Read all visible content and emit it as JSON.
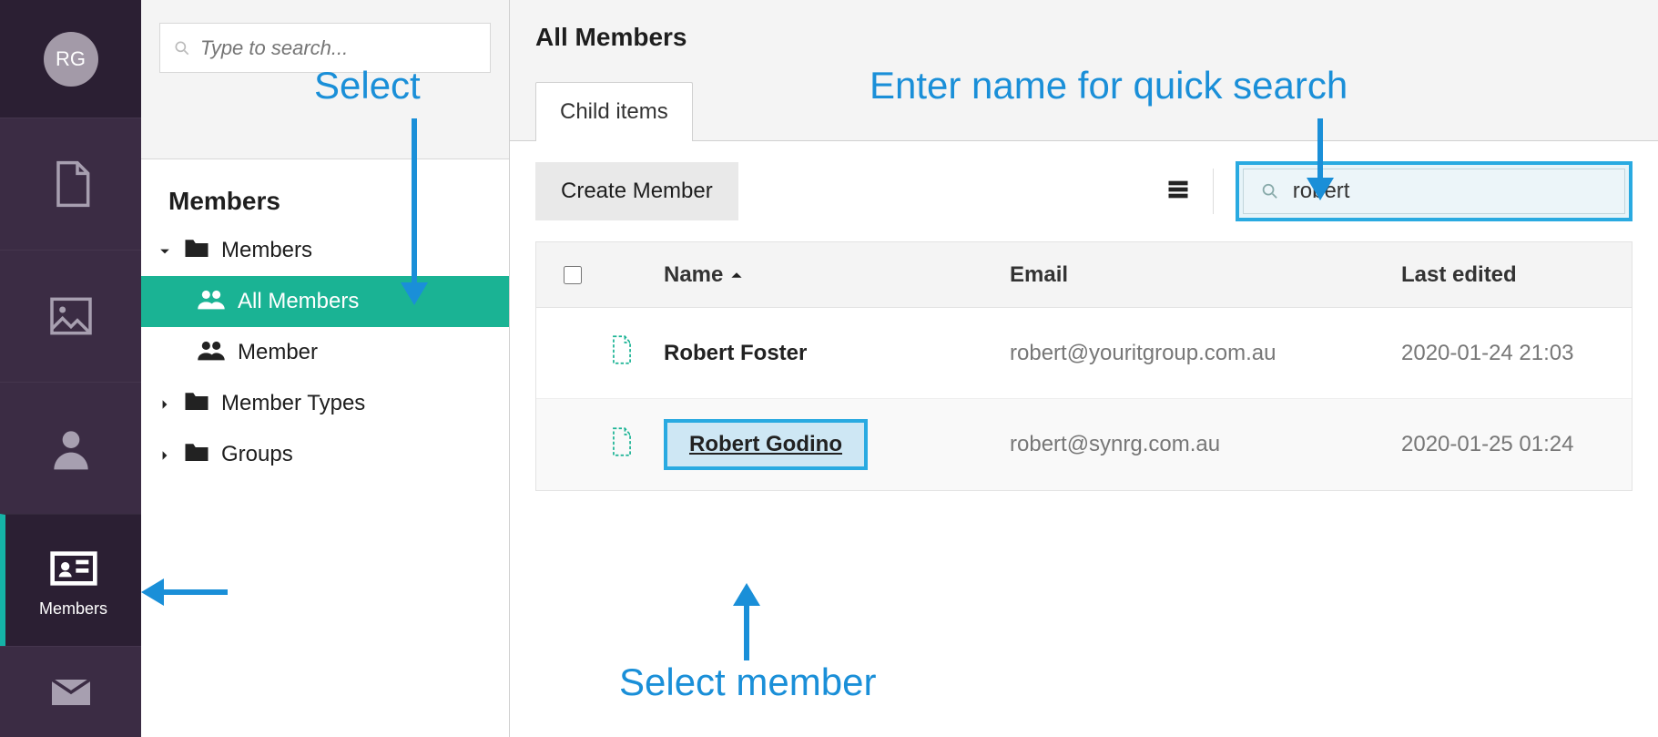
{
  "avatar_initials": "RG",
  "rail": {
    "items": [
      {
        "id": "content",
        "label": ""
      },
      {
        "id": "media",
        "label": ""
      },
      {
        "id": "users",
        "label": ""
      },
      {
        "id": "members",
        "label": "Members"
      },
      {
        "id": "mail",
        "label": ""
      }
    ]
  },
  "global_search": {
    "placeholder": "Type to search..."
  },
  "tree": {
    "heading": "Members",
    "nodes": {
      "members_root": "Members",
      "all_members": "All Members",
      "member": "Member",
      "member_types": "Member Types",
      "groups": "Groups"
    }
  },
  "main": {
    "title": "All Members",
    "tab_label": "Child items",
    "create_button": "Create Member",
    "search_value": "robert",
    "columns": {
      "name": "Name",
      "email": "Email",
      "last_edited": "Last edited"
    },
    "rows": [
      {
        "name": "Robert Foster",
        "email": "robert@youritgroup.com.au",
        "last_edited": "2020-01-24 21:03",
        "highlighted": false
      },
      {
        "name": "Robert Godino",
        "email": "robert@synrg.com.au",
        "last_edited": "2020-01-25 01:24",
        "highlighted": true
      }
    ]
  },
  "annotations": {
    "select": "Select",
    "enter_search": "Enter name for quick search",
    "select_member": "Select member"
  }
}
